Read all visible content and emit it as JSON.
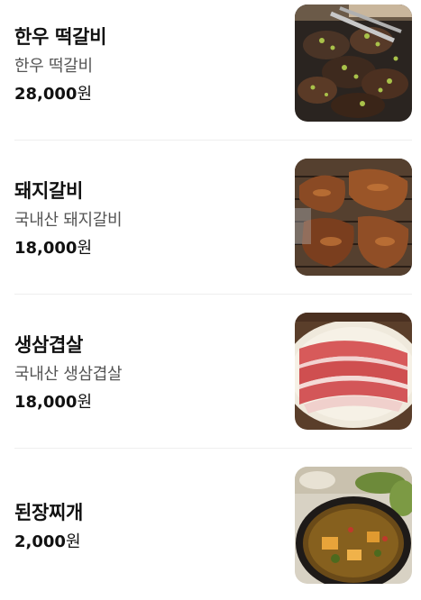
{
  "menu": {
    "items": [
      {
        "name": "한우 떡갈비",
        "description": "한우 떡갈비",
        "price": "28,000",
        "currency": "원",
        "image_icon": "grilled-tteokgalbi-photo"
      },
      {
        "name": "돼지갈비",
        "description": "국내산 돼지갈비",
        "price": "18,000",
        "currency": "원",
        "image_icon": "pork-galbi-photo"
      },
      {
        "name": "생삼겹살",
        "description": "국내산 생삼겹살",
        "price": "18,000",
        "currency": "원",
        "image_icon": "pork-belly-photo"
      },
      {
        "name": "된장찌개",
        "price": "2,000",
        "currency": "원",
        "image_icon": "doenjang-stew-photo"
      }
    ]
  }
}
